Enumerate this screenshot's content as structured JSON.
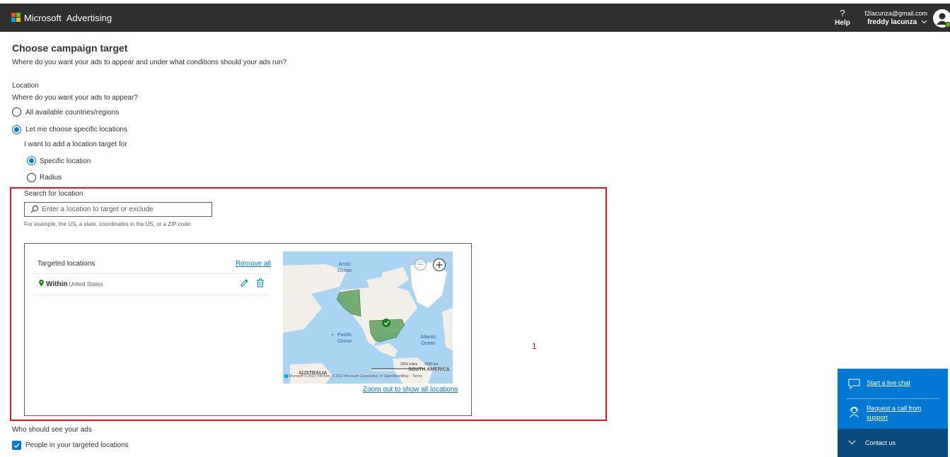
{
  "header": {
    "brand_ms": "Microsoft",
    "brand_product": "Advertising",
    "help_symbol": "?",
    "help_label": "Help",
    "user_email": "f2lacunza@gmail.com",
    "user_name": "freddy lacunza",
    "colors": {
      "bar": "#2f2f2f",
      "logo_red": "#f25022",
      "logo_green": "#7fba00",
      "logo_blue": "#00a4ef",
      "logo_yellow": "#ffb900",
      "presence": "#6bb700"
    }
  },
  "page": {
    "title": "Choose campaign target",
    "subtitle": "Where do you want your ads to appear and under what conditions should your ads run?"
  },
  "location": {
    "heading": "Location",
    "question": "Where do you want your ads to appear?",
    "options": [
      {
        "label": "All available countries/regions",
        "selected": false
      },
      {
        "label": "Let me choose specific locations",
        "selected": true
      }
    ],
    "target_prompt": "I want to add a location target for",
    "target_options": [
      {
        "label": "Specific location",
        "selected": true
      },
      {
        "label": "Radius",
        "selected": false
      }
    ]
  },
  "search": {
    "label": "Search for location",
    "placeholder": "Enter a location to target or exclude",
    "hint": "For example, the US, a state, coordinates in the US, or a ZIP code."
  },
  "targeted": {
    "heading": "Targeted locations",
    "remove_all": "Remove all",
    "items": [
      {
        "prefix": "Within",
        "name": "United States"
      }
    ]
  },
  "map": {
    "labels": {
      "arctic_1": "Arctic",
      "arctic_2": "Ocean",
      "pacific_1": "Pacific",
      "pacific_2": "Ocean",
      "atlantic_1": "Atlantic",
      "atlantic_2": "Ocean",
      "australia": "AUSTRALIA",
      "south_america": "SOUTH AMERICA"
    },
    "scale_miles": "2500 miles",
    "scale_km": "2500 km",
    "attribution": "Microsoft © 2022 TomTom, © 2022 Microsoft Corporation, © OpenStreetMap",
    "terms": "Terms",
    "zoom_out_link": "Zoom out to show all locations",
    "colors": {
      "water": "#abd3f2",
      "land": "#f2efe9",
      "target": "#5fa05f",
      "ice": "#ffffff"
    }
  },
  "annotation": {
    "number": "1",
    "color": "#e81123"
  },
  "audience": {
    "heading": "Who should see your ads",
    "checkbox_label": "People in your targeted locations",
    "checked": true
  },
  "contact": {
    "live_chat": "Start a live chat",
    "call_line1": "Request a call from",
    "call_line2": "support",
    "contact_us": "Contact us",
    "colors": {
      "primary": "#0078d4",
      "dark": "#0a4a7c"
    }
  }
}
